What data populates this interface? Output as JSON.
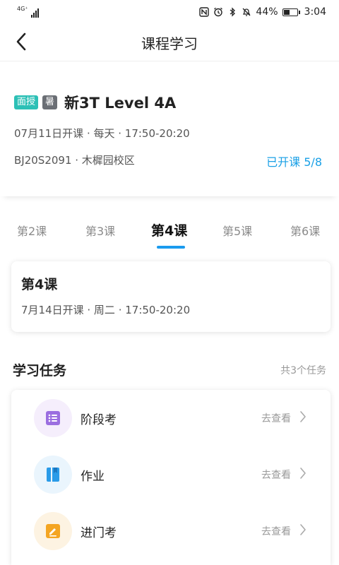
{
  "status_bar": {
    "network": "4G⁺",
    "battery": "44%",
    "time": "3:04"
  },
  "header": {
    "title": "课程学习",
    "back_icon": "chevron-left-icon"
  },
  "course": {
    "tag1": "面授",
    "tag2": "暑",
    "name": "新3T Level 4A",
    "schedule": "07月11日开课 · 每天 · 17:50-20:20",
    "campus": "BJ20S2091 · 木樨园校区",
    "status": "已开课 5/8",
    "colors": {
      "tag1_bg": "#2cc0b6",
      "tag2_bg": "#6b6f75",
      "status": "#1aa0e6"
    }
  },
  "tabs": {
    "items": [
      {
        "label": "第2课"
      },
      {
        "label": "第3课"
      },
      {
        "label": "第4课"
      },
      {
        "label": "第5课"
      },
      {
        "label": "第6课"
      }
    ],
    "active_index": 2,
    "accent": "#1a9bef"
  },
  "lesson": {
    "title": "第4课",
    "schedule": "7月14日开课 · 周二 · 17:50-20:20"
  },
  "tasks_section": {
    "title": "学习任务",
    "count": "共3个任务",
    "items": [
      {
        "label": "阶段考",
        "action": "去查看",
        "icon": "list-document-icon",
        "color": "#9b6ee0",
        "bg": "#f5eefc"
      },
      {
        "label": "作业",
        "action": "去查看",
        "icon": "book-icon",
        "color": "#2a9be8",
        "bg": "#eaf5fd"
      },
      {
        "label": "进门考",
        "action": "去查看",
        "icon": "edit-pen-icon",
        "color": "#f4a522",
        "bg": "#fdf3e2"
      }
    ]
  }
}
